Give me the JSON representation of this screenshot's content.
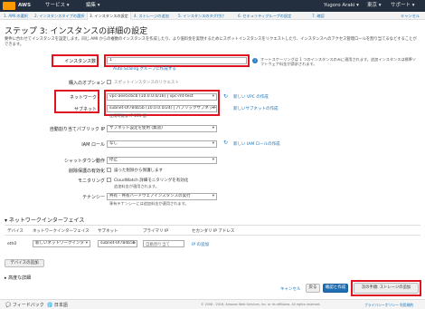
{
  "topbar": {
    "brand": "AWS",
    "services": "サービス ▾",
    "edit": "編集 ▾",
    "user": "Yugoro Araki ▾",
    "region": "東京 ▾",
    "support": "サポート ▾"
  },
  "steps": [
    "1. AMI の選択",
    "2. インスタンスタイプの選択",
    "3. インスタンスの設定",
    "4. ストレージの追加",
    "5. インスタンスのタグ付け",
    "6. セキュリティグループの設定",
    "7. 確認"
  ],
  "cancel": "キャンセル",
  "title": "ステップ 3: インスタンスの詳細の設定",
  "description": "要件に合わせてインスタンスを設定します。同じ AMI からの複数のインスタンスを作成したり、より低料金を実現するためにスポットインスタンスをリクエストしたり、インスタンスへのアクセス管理ロールを割り当てるなどすることができます。",
  "form": {
    "count_label": "インスタンス数",
    "count_value": "1",
    "count_hint": "オートスケーリングは 1 つのインスタンスのみに適用されます。追加インスタンスは標準ソフトウェア料金が請求されます。",
    "autoscale_link": "Auto Scaling グループに作成する",
    "purchase_label": "購入のオプション",
    "spot_label": "スポットインスタンスのリクエスト",
    "network_label": "ネットワーク",
    "network_value": "vpc-aee5cbcb (10.0.0.0/16) | vpc-mt-test",
    "vpc_link": "新しい VPC の作成",
    "subnet_label": "サブネット",
    "subnet_value": "subnet-0f784b5b (10.0.0.0/24) | パブリックサブネット | a",
    "subnet_ips": "使用可能な IP 251 個",
    "subnet_link": "新しいサブネットの作成",
    "publicip_label": "自動割り当てパブリック IP",
    "publicip_value": "サブネット設定を使用 (無効)",
    "iam_label": "IAM ロール",
    "iam_value": "なし",
    "iam_link": "新しい IAM ロールの作成",
    "shutdown_label": "シャットダウン動作",
    "shutdown_value": "停止",
    "termprot_label": "削除保護の有効化",
    "termprot_check": "誤った削除から保護します",
    "monitor_label": "モニタリング",
    "monitor_check": "CloudWatch 詳細モニタリングを有効化",
    "monitor_hint": "追加料金が適用されます。",
    "tenancy_label": "テナンシー",
    "tenancy_value": "共有 - 共有ハードウェアインスタンスの実行",
    "tenancy_hint": "専有テナンシーには追加料金が適用されます。"
  },
  "network_if": {
    "title": "ネットワークインターフェイス",
    "columns": [
      "デバイス",
      "ネットワークインターフェイス",
      "サブネット",
      "プライマリ IP",
      "セカンダリ IP アドレス"
    ],
    "row": {
      "device": "eth0",
      "iface": "新しいネットワークインタ",
      "subnet": "subnet-0f784b5b",
      "ip_placeholder": "自動割り当て",
      "secondary_link": "IP の追加"
    },
    "add_button": "デバイスの追加"
  },
  "advanced": "高度な詳細",
  "buttons": {
    "cancel": "キャンセル",
    "back": "戻る",
    "review": "確認と作成",
    "next": "次の手順: ストレージの追加"
  },
  "footer": {
    "feedback": "フィードバック",
    "lang": "日本語",
    "copyright": "© 2008 - 2016, Amazon Web Services, Inc. or its affiliates. All rights reserved.",
    "privacy": "プライバシーポリシー",
    "terms": "利用規約"
  }
}
